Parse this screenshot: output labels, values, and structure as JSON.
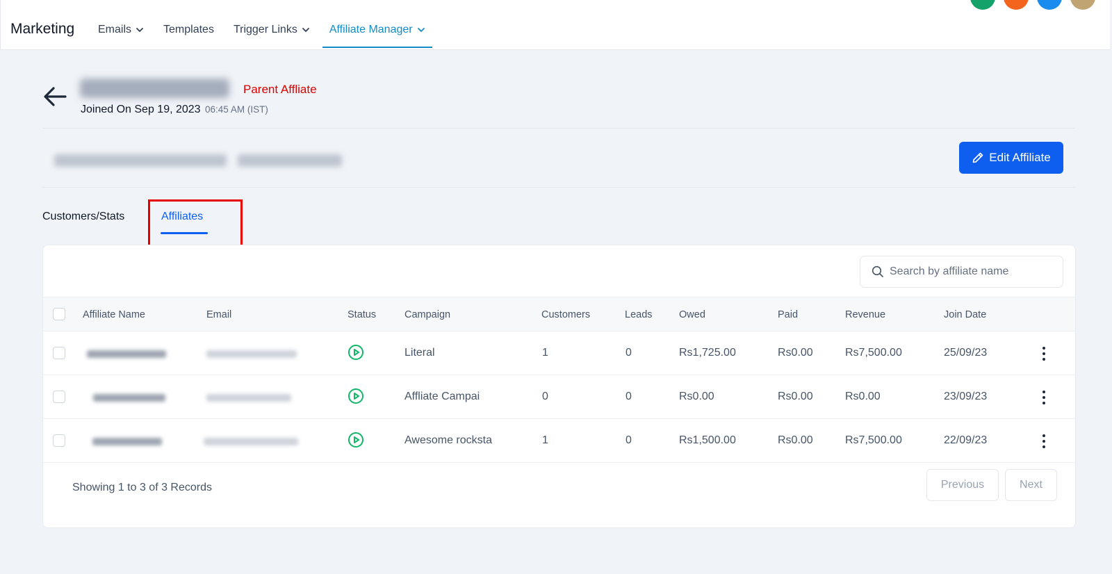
{
  "app": {
    "title": "Marketing"
  },
  "nav": {
    "items": [
      {
        "label": "Emails",
        "dropdown": true,
        "active": false
      },
      {
        "label": "Templates",
        "dropdown": false,
        "active": false
      },
      {
        "label": "Trigger Links",
        "dropdown": true,
        "active": false
      },
      {
        "label": "Affiliate Manager",
        "dropdown": true,
        "active": true
      }
    ]
  },
  "header": {
    "badge": "Parent Affliate",
    "joined_label": "Joined On Sep 19, 2023",
    "joined_time": "06:45 AM (IST)",
    "edit_button": "Edit Affiliate"
  },
  "tabs": [
    {
      "label": "Customers/Stats",
      "active": false
    },
    {
      "label": "Affiliates",
      "active": true
    }
  ],
  "table": {
    "search_placeholder": "Search by affiliate name",
    "columns": [
      "Affiliate Name",
      "Email",
      "Status",
      "Campaign",
      "Customers",
      "Leads",
      "Owed",
      "Paid",
      "Revenue",
      "Join Date"
    ],
    "rows": [
      {
        "campaign": "Literal",
        "customers": "1",
        "leads": "0",
        "owed": "Rs1,725.00",
        "paid": "Rs0.00",
        "revenue": "Rs7,500.00",
        "join_date": "25/09/23"
      },
      {
        "campaign": "Affliate Campai",
        "customers": "0",
        "leads": "0",
        "owed": "Rs0.00",
        "paid": "Rs0.00",
        "revenue": "Rs0.00",
        "join_date": "23/09/23"
      },
      {
        "campaign": "Awesome rocksta",
        "customers": "1",
        "leads": "0",
        "owed": "Rs1,500.00",
        "paid": "Rs0.00",
        "revenue": "Rs7,500.00",
        "join_date": "22/09/23"
      }
    ],
    "footer_text": "Showing 1 to 3 of 3 Records",
    "prev_label": "Previous",
    "next_label": "Next"
  },
  "colors": {
    "accent": "#0e5ff0",
    "nav_active": "#158bc6",
    "status_active": "#12b76a",
    "badge_red": "#e00000"
  }
}
